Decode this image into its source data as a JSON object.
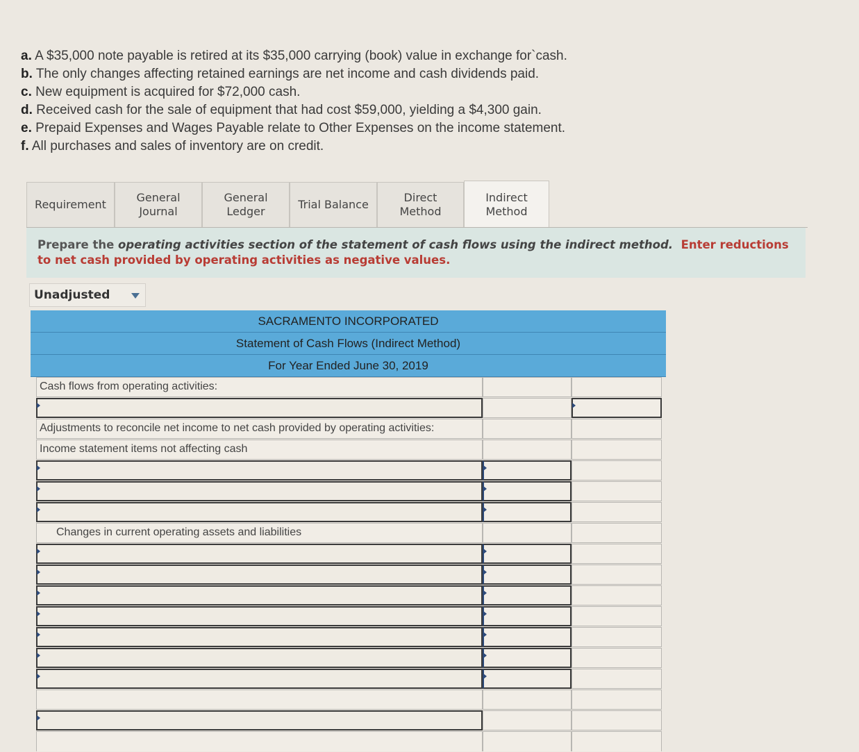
{
  "requirements": [
    {
      "letter": "a.",
      "text": "A $35,000 note payable is retired at its $35,000 carrying (book) value in exchange for`cash."
    },
    {
      "letter": "b.",
      "text": "The only changes affecting retained earnings are net income and cash dividends paid."
    },
    {
      "letter": "c.",
      "text": "New equipment is acquired for $72,000 cash."
    },
    {
      "letter": "d.",
      "text": "Received cash for the sale of equipment that had cost $59,000, yielding a $4,300 gain."
    },
    {
      "letter": "e.",
      "text": "Prepaid Expenses and Wages Payable relate to Other Expenses on the income statement."
    },
    {
      "letter": "f.",
      "text": "All purchases and sales of inventory are on credit."
    }
  ],
  "tabs": [
    {
      "label": "Requirement",
      "active": false
    },
    {
      "label": "General Journal",
      "active": false
    },
    {
      "label": "General Ledger",
      "active": false
    },
    {
      "label": "Trial Balance",
      "active": false
    },
    {
      "label": "Direct Method",
      "active": false
    },
    {
      "label": "Indirect Method",
      "active": true
    }
  ],
  "instructions": {
    "prefix": "Prepare the ",
    "italic": "operating activities section of the statement of cash flows using the indirect method.",
    "red": "Enter reductions to net cash provided by operating activities as negative values."
  },
  "dropdown": {
    "selected": "Unadjusted"
  },
  "statement": {
    "company": "SACRAMENTO INCORPORATED",
    "title": "Statement of Cash Flows (Indirect Method)",
    "period": "For Year Ended June 30, 2019",
    "labels": {
      "operating": "Cash flows from operating activities:",
      "adjustments": "Adjustments to reconcile net income to net cash provided by operating activities:",
      "noncash": "Income statement items not affecting cash",
      "changes": "Changes in current operating assets and liabilities"
    }
  }
}
